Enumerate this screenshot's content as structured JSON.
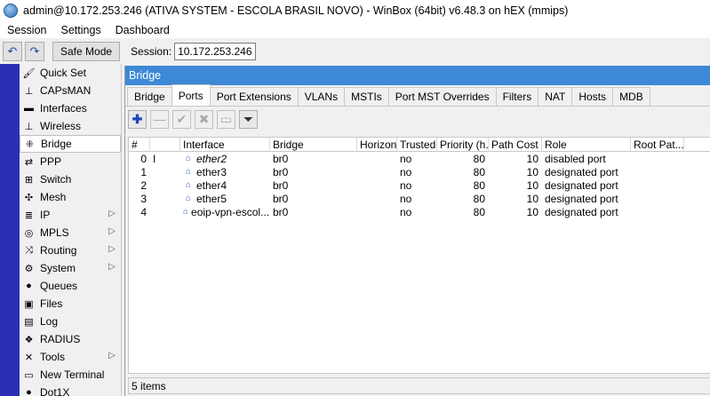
{
  "window_title": "admin@10.172.253.246 (ATIVA SYSTEM - ESCOLA BRASIL NOVO) - WinBox (64bit) v6.48.3 on hEX (mmips)",
  "menu": [
    "Session",
    "Settings",
    "Dashboard"
  ],
  "toolbar": {
    "safe_mode": "Safe Mode",
    "session_label": "Session:",
    "session_value": "10.172.253.246"
  },
  "nav": [
    {
      "label": "Quick Set",
      "icon": "quickset-icon",
      "glyph": "🖌",
      "arrow": ""
    },
    {
      "label": "CAPsMAN",
      "icon": "capsman-icon",
      "glyph": "⊥",
      "arrow": ""
    },
    {
      "label": "Interfaces",
      "icon": "interfaces-icon",
      "glyph": "▬",
      "arrow": ""
    },
    {
      "label": "Wireless",
      "icon": "wireless-icon",
      "glyph": "⊥",
      "arrow": ""
    },
    {
      "label": "Bridge",
      "icon": "bridge-icon",
      "glyph": "⁜",
      "arrow": ""
    },
    {
      "label": "PPP",
      "icon": "ppp-icon",
      "glyph": "⇄",
      "arrow": ""
    },
    {
      "label": "Switch",
      "icon": "switch-icon",
      "glyph": "⊞",
      "arrow": ""
    },
    {
      "label": "Mesh",
      "icon": "mesh-icon",
      "glyph": "✣",
      "arrow": ""
    },
    {
      "label": "IP",
      "icon": "ip-icon",
      "glyph": "≣",
      "arrow": "▷"
    },
    {
      "label": "MPLS",
      "icon": "mpls-icon",
      "glyph": "◎",
      "arrow": "▷"
    },
    {
      "label": "Routing",
      "icon": "routing-icon",
      "glyph": "⤨",
      "arrow": "▷"
    },
    {
      "label": "System",
      "icon": "system-icon",
      "glyph": "⚙",
      "arrow": "▷"
    },
    {
      "label": "Queues",
      "icon": "queues-icon",
      "glyph": "●",
      "arrow": ""
    },
    {
      "label": "Files",
      "icon": "files-icon",
      "glyph": "▣",
      "arrow": ""
    },
    {
      "label": "Log",
      "icon": "log-icon",
      "glyph": "▤",
      "arrow": ""
    },
    {
      "label": "RADIUS",
      "icon": "radius-icon",
      "glyph": "❖",
      "arrow": ""
    },
    {
      "label": "Tools",
      "icon": "tools-icon",
      "glyph": "✕",
      "arrow": "▷"
    },
    {
      "label": "New Terminal",
      "icon": "terminal-icon",
      "glyph": "▭",
      "arrow": ""
    },
    {
      "label": "Dot1X",
      "icon": "dot1x-icon",
      "glyph": "●",
      "arrow": ""
    }
  ],
  "bridge_window": {
    "title": "Bridge",
    "tabs": [
      "Bridge",
      "Ports",
      "Port Extensions",
      "VLANs",
      "MSTIs",
      "Port MST Overrides",
      "Filters",
      "NAT",
      "Hosts",
      "MDB"
    ],
    "active_tab": "Ports",
    "columns": [
      "#",
      "",
      "Interface",
      "Bridge",
      "Horizon",
      "Trusted",
      "Priority (h...",
      "Path Cost",
      "Role",
      "Root Pat..."
    ],
    "rows": [
      {
        "idx": "0",
        "flag": "I",
        "interface": "ether2",
        "bridge": "br0",
        "horizon": "",
        "trusted": "no",
        "priority": "80",
        "path_cost": "10",
        "role": "disabled port",
        "root_path": ""
      },
      {
        "idx": "1",
        "flag": "",
        "interface": "ether3",
        "bridge": "br0",
        "horizon": "",
        "trusted": "no",
        "priority": "80",
        "path_cost": "10",
        "role": "designated port",
        "root_path": ""
      },
      {
        "idx": "2",
        "flag": "",
        "interface": "ether4",
        "bridge": "br0",
        "horizon": "",
        "trusted": "no",
        "priority": "80",
        "path_cost": "10",
        "role": "designated port",
        "root_path": ""
      },
      {
        "idx": "3",
        "flag": "",
        "interface": "ether5",
        "bridge": "br0",
        "horizon": "",
        "trusted": "no",
        "priority": "80",
        "path_cost": "10",
        "role": "designated port",
        "root_path": ""
      },
      {
        "idx": "4",
        "flag": "",
        "interface": "eoip-vpn-escol...",
        "bridge": "br0",
        "horizon": "",
        "trusted": "no",
        "priority": "80",
        "path_cost": "10",
        "role": "designated port",
        "root_path": ""
      }
    ],
    "status": "5 items"
  }
}
